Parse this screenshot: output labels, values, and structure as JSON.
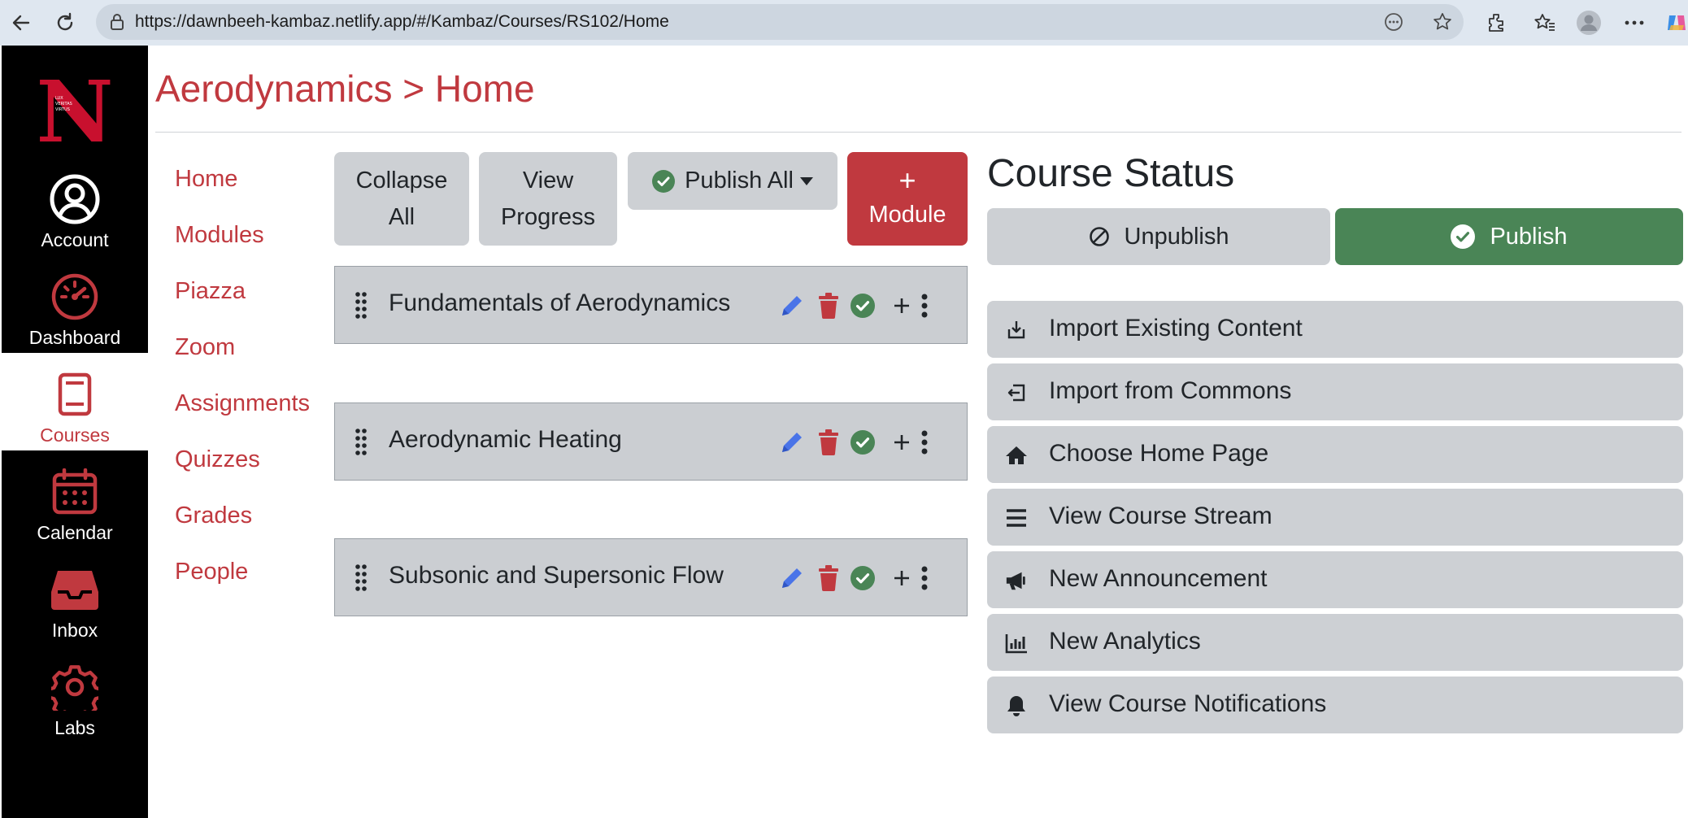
{
  "browser": {
    "url": "https://dawnbeeh-kambaz.netlify.app/#/Kambaz/Courses/RS102/Home"
  },
  "global_nav": {
    "logo_text": "N",
    "items": [
      {
        "label": "Account",
        "icon": "user-circle-icon",
        "active": false
      },
      {
        "label": "Dashboard",
        "icon": "speedometer-icon",
        "active": false
      },
      {
        "label": "Courses",
        "icon": "book-icon",
        "active": true
      },
      {
        "label": "Calendar",
        "icon": "calendar-icon",
        "active": false
      },
      {
        "label": "Inbox",
        "icon": "inbox-icon",
        "active": false
      },
      {
        "label": "Labs",
        "icon": "gear-icon",
        "active": false
      }
    ]
  },
  "header": {
    "title": "Aerodynamics > Home"
  },
  "course_nav": {
    "items": [
      "Home",
      "Modules",
      "Piazza",
      "Zoom",
      "Assignments",
      "Quizzes",
      "Grades",
      "People"
    ]
  },
  "toolbar": {
    "collapse_all": [
      "Collapse",
      "All"
    ],
    "view_progress": [
      "View",
      "Progress"
    ],
    "publish_all": "Publish All",
    "add_module": [
      "+",
      "Module"
    ]
  },
  "modules": [
    {
      "title": "Fundamentals of Aerodynamics"
    },
    {
      "title": "Aerodynamic Heating"
    },
    {
      "title": "Subsonic and Supersonic Flow"
    }
  ],
  "course_status": {
    "title": "Course Status",
    "unpublish": "Unpublish",
    "publish": "Publish",
    "actions": [
      {
        "label": "Import Existing Content",
        "icon": "import-icon"
      },
      {
        "label": "Import from Commons",
        "icon": "box-arrow-in-left-icon"
      },
      {
        "label": "Choose Home Page",
        "icon": "home-icon"
      },
      {
        "label": "View Course Stream",
        "icon": "stream-icon"
      },
      {
        "label": "New Announcement",
        "icon": "megaphone-icon"
      },
      {
        "label": "New Analytics",
        "icon": "bar-chart-icon"
      },
      {
        "label": "View Course Notifications",
        "icon": "bell-icon"
      }
    ]
  },
  "colors": {
    "accent_red": "#c0393f",
    "publish_green": "#4a8556",
    "edit_blue": "#4a74e8",
    "nav_black": "#000000"
  }
}
